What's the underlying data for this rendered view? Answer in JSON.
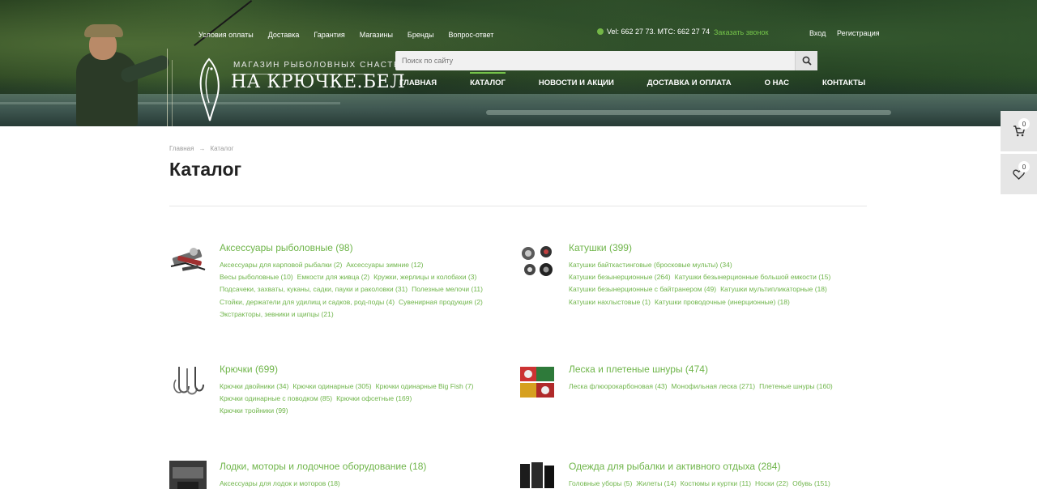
{
  "topnav": [
    "Условия оплаты",
    "Доставка",
    "Гарантия",
    "Магазины",
    "Бренды",
    "Вопрос-ответ"
  ],
  "phones": "Vel: 662 27 73. МТС: 662 27 74",
  "callback": "Заказать звонок",
  "login": "Вход",
  "register": "Регистрация",
  "logo": {
    "tagline": "МАГАЗИН РЫБОЛОВНЫХ СНАСТЕЙ",
    "name": "НА КРЮЧКЕ.БЕЛ"
  },
  "search": {
    "placeholder": "Поиск по сайту"
  },
  "mainnav": [
    "ГЛАВНАЯ",
    "КАТАЛОГ",
    "НОВОСТИ И АКЦИИ",
    "ДОСТАВКА И ОПЛАТА",
    "О НАС",
    "КОНТАКТЫ"
  ],
  "mainnav_active": "КАТАЛОГ",
  "cart": {
    "count": "0"
  },
  "favorites": {
    "count": "0"
  },
  "breadcrumb": [
    "Главная",
    "→",
    "Каталог"
  ],
  "page_title": "Каталог",
  "categories": [
    {
      "title": "Аксессуары рыболовные (98)",
      "icon": "accessories-image",
      "links": [
        "Аксессуары для карповой рыбалки (2)",
        "Аксессуары зимние (12)",
        "Весы рыболовные (10)",
        "Емкости для живца (2)",
        "Кружки, жерлицы и колобахи (3)",
        "Подсачеки, захваты, куканы, садки, пауки и раколовки (31)",
        "Полезные мелочи (11)",
        "Стойки, держатели для удилищ и садков, род-поды (4)",
        "Сувенирная продукция (2)",
        "Экстракторы, зевники и щипцы (21)"
      ]
    },
    {
      "title": "Катушки (399)",
      "icon": "reels-image",
      "links": [
        "Катушки байткастинговые (бросковые мульты) (34)",
        "Катушки безынерционные (264)",
        "Катушки безынерционные большой емкости (15)",
        "Катушки безынерционные с байтранером (49)",
        "Катушки мультипликаторные (18)",
        "Катушки нахлыстовые (1)",
        "Катушки проводочные (инерционные) (18)"
      ]
    },
    {
      "title": "Крючки (699)",
      "icon": "hooks-image",
      "links": [
        "Крючки двойники (34)",
        "Крючки одинарные (305)",
        "Крючки одинарные Big Fish (7)",
        "Крючки одинарные с поводком (85)",
        "Крючки офсетные (169)",
        "Крючки тройники (99)"
      ]
    },
    {
      "title": "Леска и плетеные шнуры (474)",
      "icon": "line-image",
      "links": [
        "Леска флюорокарбоновая (43)",
        "Монофильная леска (271)",
        "Плетеные шнуры (160)"
      ]
    },
    {
      "title": "Лодки, моторы и лодочное оборудование (18)",
      "icon": "boats-image",
      "links": [
        "Аксессуары для лодок и моторов (18)"
      ]
    },
    {
      "title": "Одежда для рыбалки и активного отдыха (284)",
      "icon": "clothing-image",
      "links": [
        "Головные уборы (5)",
        "Жилеты (14)",
        "Костюмы и куртки (11)",
        "Носки (22)",
        "Обувь (151)"
      ]
    }
  ],
  "colors": {
    "accent": "#6fb54a",
    "title": "#222222",
    "muted": "#9a9a9a"
  }
}
